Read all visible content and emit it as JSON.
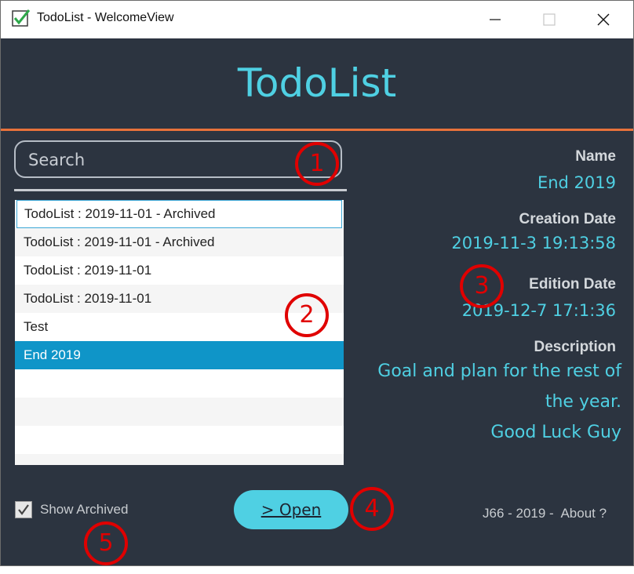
{
  "window": {
    "title": "TodoList - WelcomeView",
    "minimize_glyph": "—",
    "maximize_glyph": "☐",
    "close_glyph": "✕",
    "icon": "checkmark-icon"
  },
  "header": {
    "app_title": "TodoList"
  },
  "search": {
    "placeholder": "Search",
    "value": ""
  },
  "todo_list": {
    "items": [
      {
        "label": "TodoList : 2019-11-01 - Archived",
        "state": "focused"
      },
      {
        "label": "TodoList : 2019-11-01 - Archived",
        "state": "normal"
      },
      {
        "label": "TodoList : 2019-11-01",
        "state": "normal"
      },
      {
        "label": "TodoList : 2019-11-01",
        "state": "normal"
      },
      {
        "label": "Test",
        "state": "normal"
      },
      {
        "label": "End 2019",
        "state": "selected"
      },
      {
        "label": "",
        "state": "empty"
      },
      {
        "label": "",
        "state": "empty"
      },
      {
        "label": "",
        "state": "empty"
      },
      {
        "label": "",
        "state": "empty"
      }
    ]
  },
  "details": {
    "name_label": "Name",
    "name_value": "End 2019",
    "creation_label": "Creation Date",
    "creation_value": "2019-11-3 19:13:58",
    "edition_label": "Edition Date",
    "edition_value": "2019-12-7 17:1:36",
    "description_label": "Description",
    "description_line1": "Goal and plan for the rest of",
    "description_line2": "the year.",
    "description_line3": "Good Luck Guy"
  },
  "footer": {
    "show_archived_label": "Show Archived",
    "show_archived_checked": true,
    "open_button_label": "> Open",
    "credit": "J66 - 2019 -",
    "about_link": "About ?"
  },
  "annotations": {
    "m1": "1",
    "m2": "2",
    "m3": "3",
    "m4": "4",
    "m5": "5"
  },
  "colors": {
    "background": "#2c3440",
    "accent": "#4fd0e3",
    "divider": "#e8723b",
    "selection": "#0f95c8",
    "annotation": "#e00000"
  }
}
